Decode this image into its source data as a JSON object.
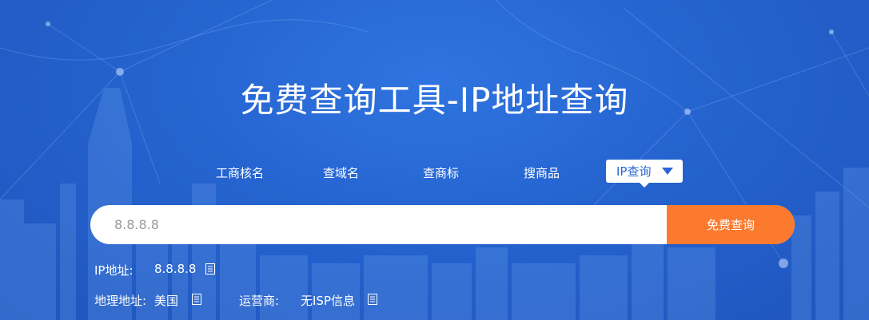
{
  "title": "免费查询工具-IP地址查询",
  "tabs": [
    {
      "label": "工商核名"
    },
    {
      "label": "查域名"
    },
    {
      "label": "查商标"
    },
    {
      "label": "搜商品"
    }
  ],
  "active_tab": {
    "label": "IP查询",
    "icon": "caret-down-icon"
  },
  "search": {
    "placeholder": "8.8.8.8",
    "button_label": "免费查询"
  },
  "result": {
    "ip_label": "IP地址:",
    "ip_value": "8.8.8.8",
    "geo_label": "地理地址:",
    "geo_value": "美国",
    "isp_label": "运营商:",
    "isp_value": "无ISP信息",
    "copy_icon": "copy-icon"
  },
  "colors": {
    "background": "#2563cf",
    "accent": "#fb7a2e",
    "tab_text_active": "#2b65d4"
  }
}
